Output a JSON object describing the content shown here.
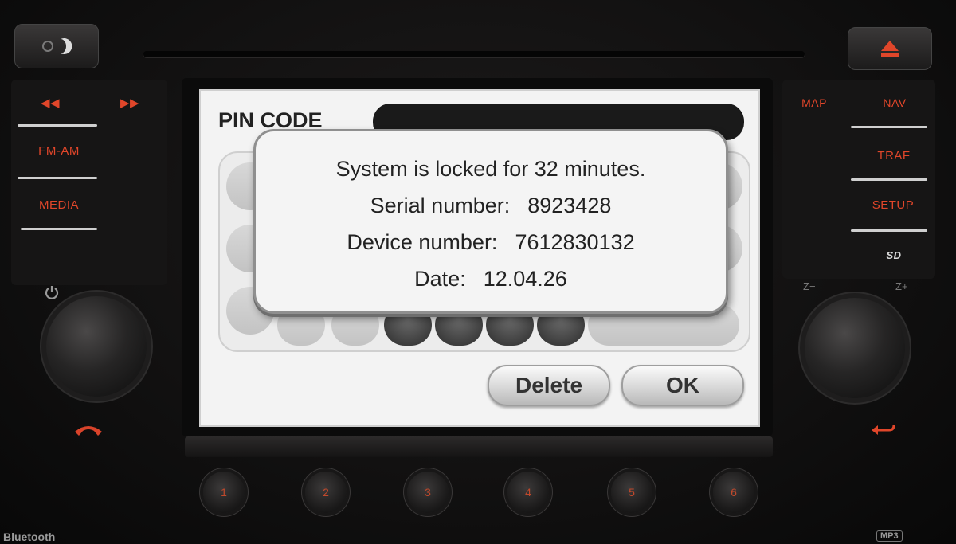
{
  "screen": {
    "title": "PIN CODE",
    "dialog": {
      "lock_message": "System is locked for 32 minutes.",
      "serial_label": "Serial number:",
      "serial_value": "8923428",
      "device_label": "Device number:",
      "device_value": "7612830132",
      "date_label": "Date:",
      "date_value": "12.04.26"
    },
    "buttons": {
      "delete": "Delete",
      "ok": "OK"
    }
  },
  "left_panel": {
    "prev_label": "◀◀",
    "next_label": "▶▶",
    "fm_am": "FM-AM",
    "media": "MEDIA"
  },
  "right_panel": {
    "map": "MAP",
    "nav": "NAV",
    "traf": "TRAF",
    "setup": "SETUP",
    "sd": "SD",
    "zoom_out": "Z−",
    "zoom_in": "Z+"
  },
  "presets": [
    "1",
    "2",
    "3",
    "4",
    "5",
    "6"
  ],
  "footer": {
    "bluetooth": "Bluetooth",
    "mp3": "MP3"
  },
  "colors": {
    "button_text": "#e0462a",
    "screen_bg": "#f3f3f3",
    "dialog_border": "#8f8f8f"
  },
  "icons": [
    "day-night-icon",
    "eject-icon",
    "power-icon",
    "phone-hangup-icon",
    "back-icon"
  ]
}
